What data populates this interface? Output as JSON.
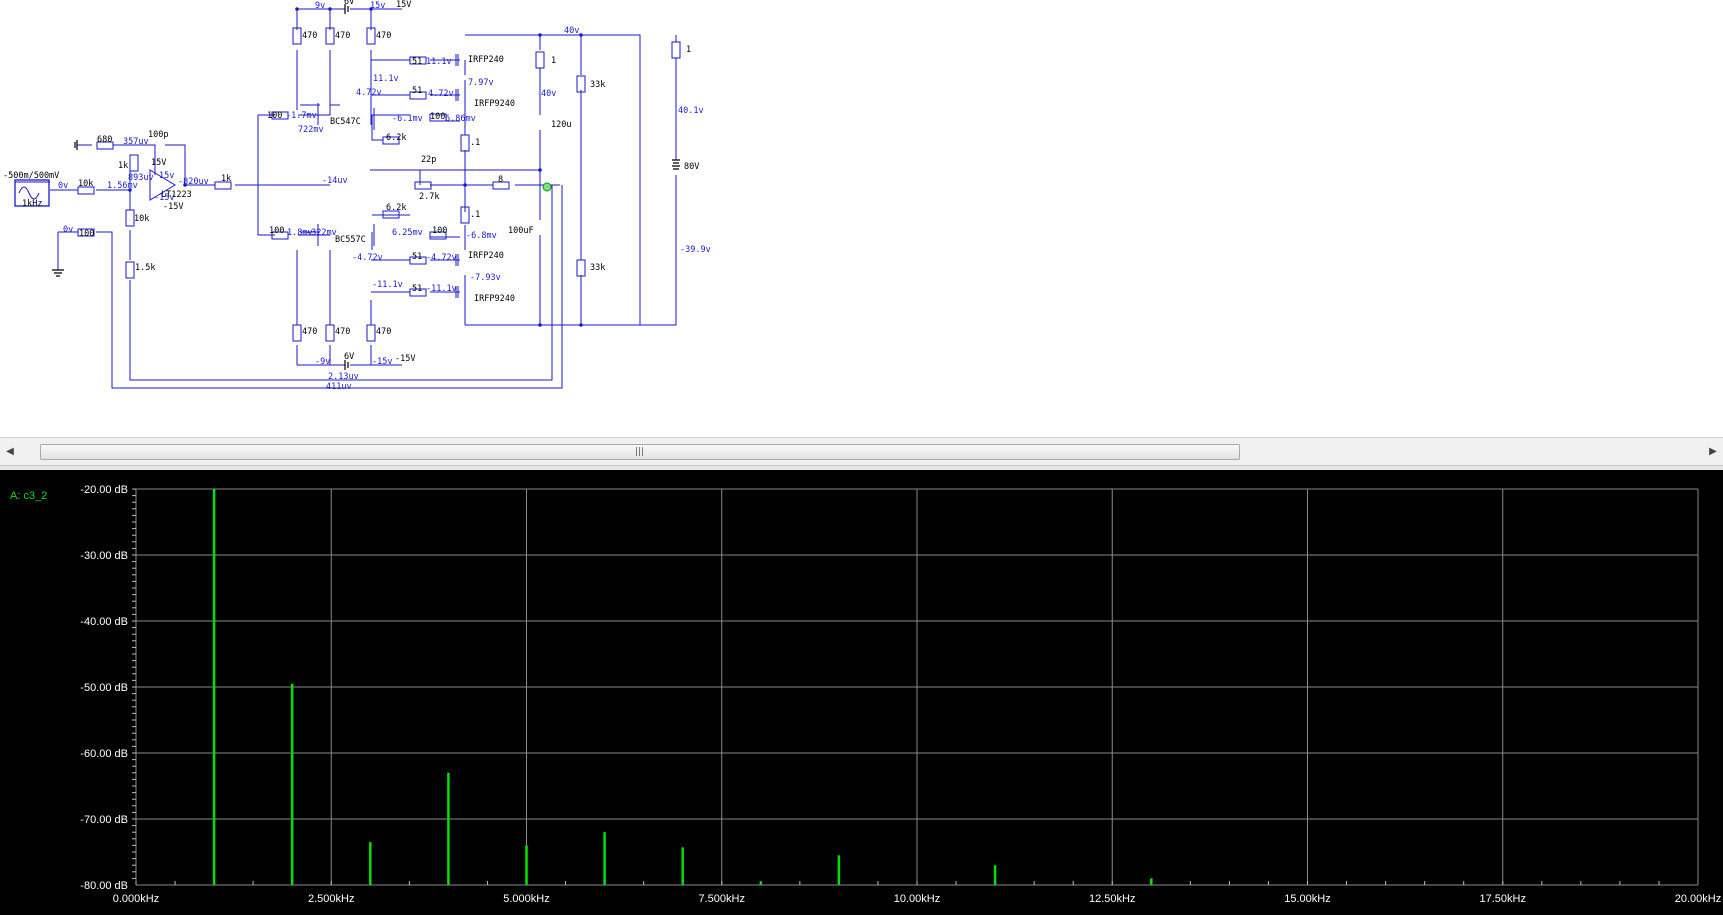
{
  "schematic": {
    "source": {
      "range_label": "-500m/500mV",
      "freq_label": "1kHz"
    },
    "labels": {
      "v_9": "9v",
      "bat_top": "6V",
      "v_15": "15v",
      "v_15V": "15V",
      "r470_a": "470",
      "r470_b": "470",
      "r470_c": "470",
      "r51_a": "51",
      "v_11_1": "11.1v",
      "irfp240_top": "IRFP240",
      "v_11_1b": "11.1v",
      "r51_b": "51",
      "v_4_72": "4.72v",
      "v_7_97": "7.97v",
      "v_4_72b": "4.72v",
      "irfp9240_top": "IRFP9240",
      "r1_top": "1",
      "v_40a": "40v",
      "v_40b": "40v",
      "r1_right": "1",
      "r33k_top": "33k",
      "v_40_1": "40.1v",
      "c120u": "120u",
      "r100_a": "100",
      "v_m1_7": "-1.7mv",
      "q_bc547": "BC547C",
      "v_722": "722mv",
      "v_m6_1": "-6.1mv",
      "r100_b": "100",
      "v_6_86": "6.86mv",
      "r6_2k_a": "6.2k",
      "r_0_1a": ".1",
      "r680": "680",
      "v_357": "357uv",
      "c100p": "100p",
      "v_15V_op": "15V",
      "r1k_a": "1k",
      "v_893": "893uv",
      "v_15v_op": "15v",
      "v_m820": "-820uv",
      "r1k_b": "1k",
      "opamp": "LT1223",
      "v_m15V": "-15V",
      "v_m15v": "-15v",
      "v_0a": "0v",
      "r10k_a": "10k",
      "v_1_56": "1.56mv",
      "r10k_b": "10k",
      "v_0b": "0v",
      "r100_c": "100",
      "r1_5k": "1.5k",
      "v_m14": "-14uv",
      "c22p": "22p",
      "r2_7k": "2.7k",
      "r8": "8",
      "probe": "A",
      "v_80V": "80V",
      "r_0_1b": ".1",
      "c100uF": "100uF",
      "r6_2k_b": "6.2k",
      "r100_d": "100",
      "v_1_8": "1.8mv",
      "v_m322": "-322mv",
      "q_bc557": "BC557C",
      "v_6_25": "6.25mv",
      "r100_e": "100",
      "v_m6_8": "-6.8mv",
      "v_m39_9": "-39.9v",
      "r33k_bot": "33k",
      "v_m4_72": "-4.72v",
      "r51_c": "51",
      "v_m4_72b": "-4.72v",
      "irfp240_bot": "IRFP240",
      "v_m7_93": "-7.93v",
      "v_m11_1": "-11.1v",
      "r51_d": "51",
      "v_m11_1b": "-11.1v",
      "irfp9240_bot": "IRFP9240",
      "r470_d": "470",
      "r470_e": "470",
      "r470_f": "470",
      "v_m9": "-9v",
      "bat_bot": "6V",
      "v_m15": "-15v",
      "v_m15V2": "-15V",
      "v_2_13": "2.13uv",
      "v_411": "411uv"
    }
  },
  "scrollbar": {
    "left_arrow": "◀",
    "right_arrow": "▶",
    "grip": "|||"
  },
  "plot": {
    "trace_label": "A: c3_2",
    "trace_color": "#00e000"
  },
  "chart_data": {
    "type": "bar",
    "title": "",
    "xlabel": "",
    "ylabel": "",
    "xlim": [
      0,
      20000
    ],
    "ylim": [
      -80,
      -20
    ],
    "x_tick_labels": [
      "0.000kHz",
      "2.500kHz",
      "5.000kHz",
      "7.500kHz",
      "10.00kHz",
      "12.50kHz",
      "15.00kHz",
      "17.50kHz",
      "20.00kHz"
    ],
    "y_tick_labels": [
      "-20.00 dB",
      "-30.00 dB",
      "-40.00 dB",
      "-50.00 dB",
      "-60.00 dB",
      "-70.00 dB",
      "-80.00 dB"
    ],
    "grid": true,
    "series": [
      {
        "name": "A: c3_2",
        "x": [
          1000,
          2000,
          3000,
          4000,
          5000,
          6000,
          7000,
          8000,
          9000,
          11000,
          13000
        ],
        "values": [
          -20.0,
          -49.5,
          -73.5,
          -63.0,
          -74.0,
          -72.0,
          -74.3,
          -79.5,
          -75.5,
          -77.0,
          -79.0
        ]
      }
    ]
  }
}
